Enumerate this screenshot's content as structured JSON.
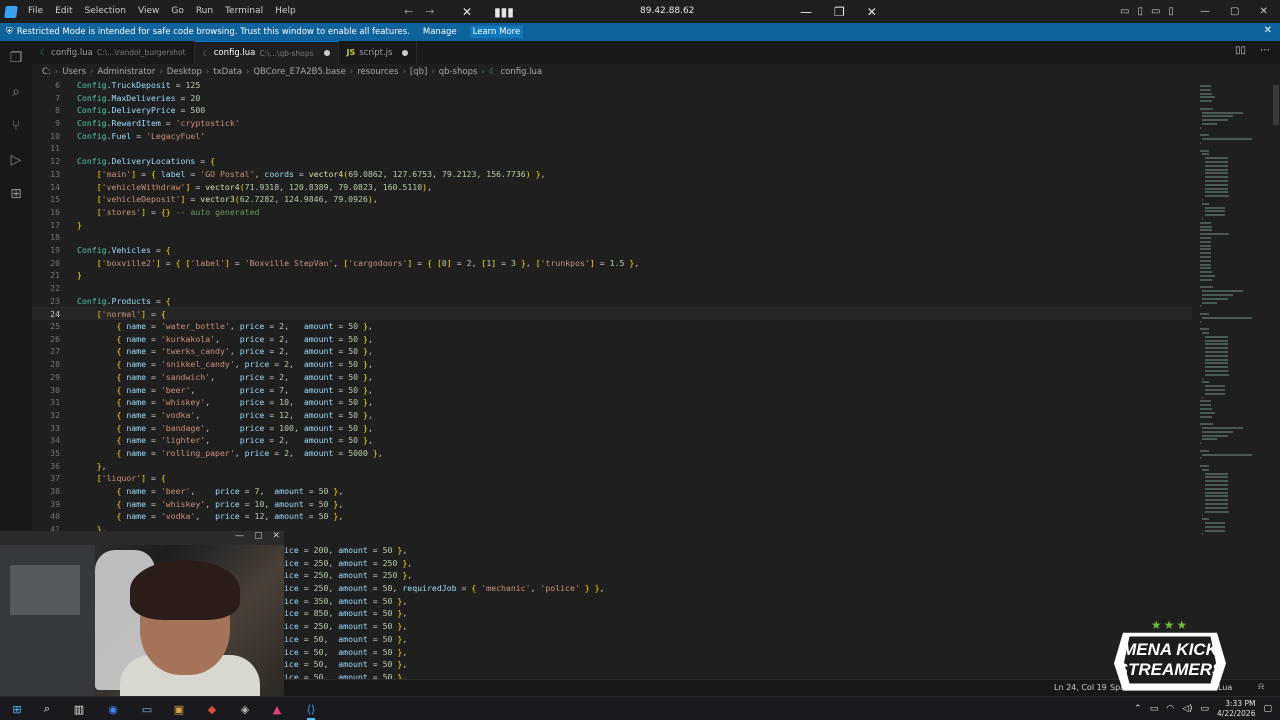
{
  "titlebar": {
    "menu": [
      "File",
      "Edit",
      "Selection",
      "View",
      "Go",
      "Run",
      "Terminal",
      "Help"
    ],
    "address": "89.42.88.62"
  },
  "banner": {
    "message": "Restricted Mode is intended for safe code browsing. Trust this window to enable all features.",
    "manage_label": "Manage",
    "learn_label": "Learn More"
  },
  "tabs": [
    {
      "name": "config.lua",
      "path": "C:\\...\\randol_burgershot",
      "active": false,
      "icon": "lua-icon"
    },
    {
      "name": "config.lua",
      "path": "C:\\...\\qb-shops",
      "active": true,
      "icon": "lua-icon"
    },
    {
      "name": "script.js",
      "path": "",
      "active": false,
      "icon": "js-icon"
    }
  ],
  "breadcrumb": [
    "C:",
    "Users",
    "Administrator",
    "Desktop",
    "txData",
    "QBCore_E7A2B5.base",
    "resources",
    "[qb]",
    "qb-shops",
    "config.lua"
  ],
  "editor": {
    "current_line": 24,
    "lines": [
      {
        "n": "6",
        "code": "Config.TruckDeposit = 125"
      },
      {
        "n": "7",
        "code": "Config.MaxDeliveries = 20"
      },
      {
        "n": "8",
        "code": "Config.DeliveryPrice = 500"
      },
      {
        "n": "9",
        "code": "Config.RewardItem = 'cryptostick'"
      },
      {
        "n": "10",
        "code": "Config.Fuel = 'LegacyFuel'"
      },
      {
        "n": "11",
        "code": ""
      },
      {
        "n": "12",
        "code": "Config.DeliveryLocations = {"
      },
      {
        "n": "13",
        "code": "    ['main'] = { label = 'GO Postal', coords = vector4(69.0862, 127.6753, 79.2123, 156.7736) },"
      },
      {
        "n": "14",
        "code": "    ['vehicleWithdraw'] = vector4(71.9318, 120.8389, 79.0823, 160.5110),"
      },
      {
        "n": "15",
        "code": "    ['vehicleDeposit'] = vector3(62.7282, 124.9846, 79.0926),"
      },
      {
        "n": "16",
        "code": "    ['stores'] = {} -- auto generated"
      },
      {
        "n": "17",
        "code": "}"
      },
      {
        "n": "18",
        "code": ""
      },
      {
        "n": "19",
        "code": "Config.Vehicles = {"
      },
      {
        "n": "20",
        "code": "    ['boxville2'] = { ['label'] = 'Boxville StepVan', ['cargodoors'] = { [0] = 2, [1] = 3 }, ['trunkpos'] = 1.5 },"
      },
      {
        "n": "21",
        "code": "}"
      },
      {
        "n": "22",
        "code": ""
      },
      {
        "n": "23",
        "code": "Config.Products = {"
      },
      {
        "n": "24",
        "code": "    ['normal'] = {"
      },
      {
        "n": "25",
        "code": "        { name = 'water_bottle', price = 2,   amount = 50 },"
      },
      {
        "n": "26",
        "code": "        { name = 'kurkakola',    price = 2,   amount = 50 },"
      },
      {
        "n": "27",
        "code": "        { name = 'twerks_candy', price = 2,   amount = 50 },"
      },
      {
        "n": "28",
        "code": "        { name = 'snikkel_candy', price = 2,  amount = 50 },"
      },
      {
        "n": "29",
        "code": "        { name = 'sandwich',     price = 2,   amount = 50 },"
      },
      {
        "n": "30",
        "code": "        { name = 'beer',         price = 7,   amount = 50 },"
      },
      {
        "n": "31",
        "code": "        { name = 'whiskey',      price = 10,  amount = 50 },"
      },
      {
        "n": "32",
        "code": "        { name = 'vodka',        price = 12,  amount = 50 },"
      },
      {
        "n": "33",
        "code": "        { name = 'bandage',      price = 100, amount = 50 },"
      },
      {
        "n": "34",
        "code": "        { name = 'lighter',      price = 2,   amount = 50 },"
      },
      {
        "n": "35",
        "code": "        { name = 'rolling_paper', price = 2,  amount = 5000 },"
      },
      {
        "n": "36",
        "code": "    },"
      },
      {
        "n": "37",
        "code": "    ['liquor'] = {"
      },
      {
        "n": "38",
        "code": "        { name = 'beer',    price = 7,  amount = 50 },"
      },
      {
        "n": "39",
        "code": "        { name = 'whiskey', price = 10, amount = 50 },"
      },
      {
        "n": "40",
        "code": "        { name = 'vodka',   price = 12, amount = 50 },"
      },
      {
        "n": "41",
        "code": "    },"
      }
    ],
    "partial_lines": [
      "ice = 200, amount = 50 },",
      "ice = 250, amount = 250 },",
      "ice = 250, amount = 250 },",
      "ice = 250, amount = 50, requiredJob = { 'mechanic', 'police' } },",
      "ice = 350, amount = 50 },",
      "ice = 850, amount = 50 },",
      "ice = 250, amount = 50 },",
      "ice = 50,  amount = 50 },",
      "ice = 50,  amount = 50 },",
      "ice = 50,  amount = 50 },",
      "ice = 50,  amount = 50 },"
    ]
  },
  "statusbar": {
    "position": "Ln 24, Col 19",
    "spaces": "Spaces: 4",
    "language": "Lua"
  },
  "overlay": {
    "line1": "MENA KICK",
    "line2": "STREAMERS"
  },
  "taskbar": {
    "time": "3:33 PM",
    "date": "4/22/2026"
  },
  "colors": {
    "accent": "#0078d4",
    "banner": "#0e639c",
    "string": "#ce9178",
    "keyword": "#569cd6",
    "number": "#b5cea8",
    "comment": "#6a9955"
  }
}
